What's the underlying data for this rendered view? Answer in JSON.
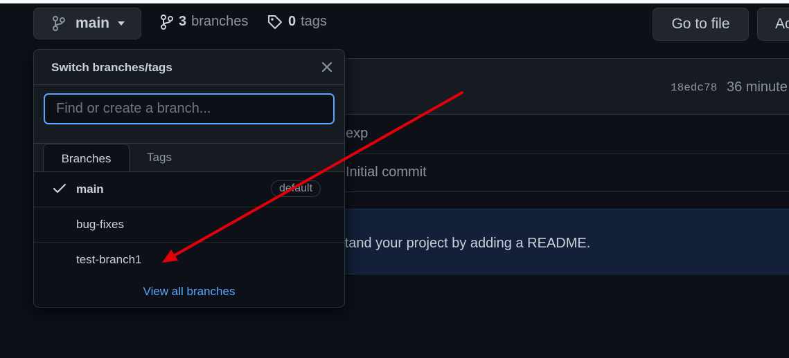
{
  "toolbar": {
    "branch_button_label": "main",
    "branches_count": "3",
    "branches_label": "branches",
    "tags_count": "0",
    "tags_label": "tags",
    "go_to_file_label": "Go to file",
    "add_file_label_partial": "Ac"
  },
  "repo": {
    "commit_sha": "18edc78",
    "commit_time_partial": "36 minute",
    "files": [
      {
        "message_partial": "exp"
      },
      {
        "message_partial": "Initial commit"
      }
    ],
    "readme_prompt_partial": "rstand your project by adding a README."
  },
  "dropdown": {
    "title": "Switch branches/tags",
    "search_placeholder": "Find or create a branch...",
    "tabs": [
      {
        "label": "Branches",
        "active": true
      },
      {
        "label": "Tags",
        "active": false
      }
    ],
    "branches": [
      {
        "name": "main",
        "selected": true,
        "badge": "default"
      },
      {
        "name": "bug-fixes",
        "selected": false
      },
      {
        "name": "test-branch1",
        "selected": false
      }
    ],
    "view_all_label": "View all branches"
  },
  "colors": {
    "background": "#0d1117",
    "panel": "#161b22",
    "border": "#30363d",
    "text": "#c9d1d9",
    "muted": "#8b949e",
    "link": "#58a6ff",
    "annotation_arrow": "#e3000b"
  },
  "icons": {
    "branch_button": "git-branch-icon",
    "branches_link": "git-branch-icon",
    "tags_link": "tag-icon",
    "close": "close-icon",
    "selected": "check-icon",
    "caret": "triangle-down-icon"
  }
}
